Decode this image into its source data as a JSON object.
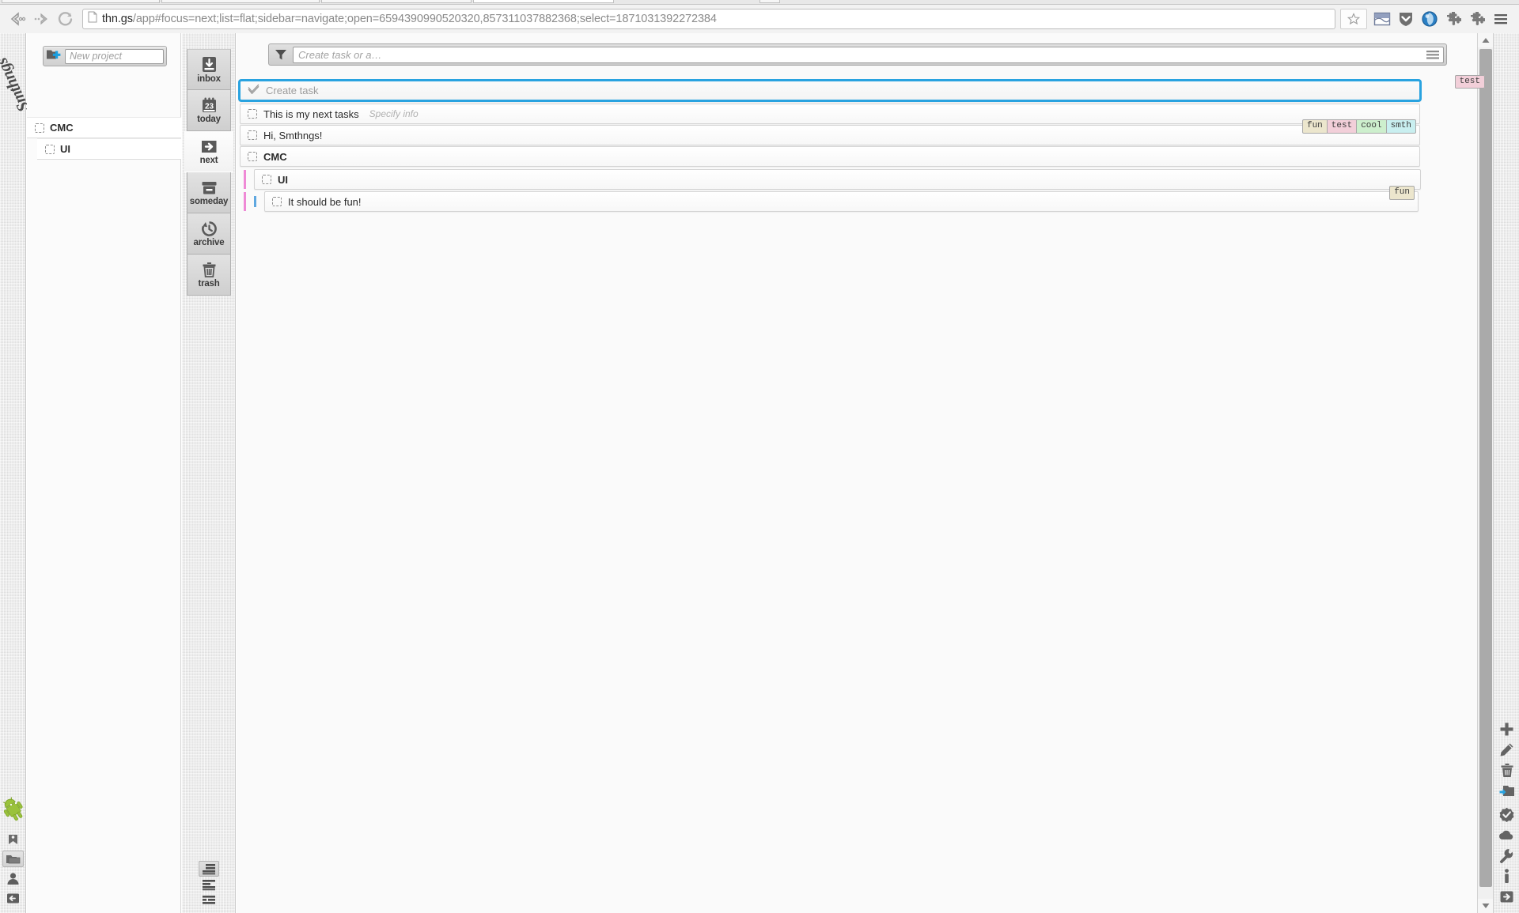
{
  "browser": {
    "url_host": "thn.gs",
    "url_path": "/app#focus=next;list=flat;sidebar=navigate;open=6594390990520320,857311037882368;select=1871031392272384",
    "back_icon": "back-arrow-icon",
    "forward_icon": "forward-arrow-icon",
    "reload_icon": "reload-icon",
    "page_icon": "page-document-icon",
    "star_icon": "bookmark-star-icon",
    "toolbar_icons": [
      "panel-split-icon",
      "shield-chevron-down-icon",
      "globe-blue-icon",
      "puzzle-piece-icon",
      "puzzle-piece-icon",
      "hamburger-menu-icon"
    ]
  },
  "brand": {
    "name": "Smthngs",
    "rail_icons": [
      "android-robot-icon",
      "tag-lock-icon",
      "folder-icon",
      "person-icon",
      "login-arrow-icon"
    ],
    "rail_selected_index": 2
  },
  "sidebar": {
    "new_project_placeholder": "New project",
    "new_project_icon": "new-folder-plus-icon",
    "projects": [
      {
        "label": "CMC",
        "level": 0,
        "icon": "dashed-checkbox-icon"
      },
      {
        "label": "UI",
        "level": 1,
        "icon": "dashed-checkbox-icon"
      }
    ]
  },
  "focus_nav": {
    "items": [
      {
        "label": "inbox",
        "icon": "inbox-download-icon",
        "active": false
      },
      {
        "label": "today",
        "icon": "calendar-23-icon",
        "active": false,
        "day": "23"
      },
      {
        "label": "next",
        "icon": "next-arrow-icon",
        "active": true
      },
      {
        "label": "someday",
        "icon": "archive-box-icon",
        "active": false
      },
      {
        "label": "archive",
        "icon": "clock-back-icon",
        "active": false
      },
      {
        "label": "trash",
        "icon": "trash-can-icon",
        "active": false
      }
    ],
    "view_toggles": [
      {
        "icon": "list-view-indented-icon",
        "selected": true
      },
      {
        "icon": "list-view-flat-icon",
        "selected": false
      },
      {
        "icon": "list-view-compact-icon",
        "selected": false
      }
    ]
  },
  "main": {
    "filter": {
      "icon": "filter-funnel-icon",
      "placeholder": "Create task or a…",
      "menu_icon": "hamburger-menu-icon"
    },
    "floating_tag": {
      "label": "test",
      "color": "#f2cfd9"
    },
    "tasks": [
      {
        "label": "Create task",
        "icon": "checkmark-outline-icon",
        "state": "create",
        "bold": false,
        "hint": "",
        "indent": 0,
        "tags": []
      },
      {
        "label": "This is my next tasks",
        "icon": "dashed-checkbox-icon",
        "state": "normal",
        "bold": false,
        "hint": "Specify info",
        "indent": 0,
        "tags": []
      },
      {
        "label": "Hi, Smthngs!",
        "icon": "dashed-checkbox-icon",
        "state": "normal",
        "bold": false,
        "hint": "",
        "indent": 0,
        "tags": [
          {
            "label": "fun",
            "color": "#ece6cd"
          },
          {
            "label": "test",
            "color": "#f2cfd9"
          },
          {
            "label": "cool",
            "color": "#cdefcd"
          },
          {
            "label": "smth",
            "color": "#c9eff0"
          }
        ]
      },
      {
        "label": "CMC",
        "icon": "dashed-checkbox-icon",
        "state": "normal",
        "bold": true,
        "hint": "",
        "indent": 0,
        "tags": []
      },
      {
        "label": "UI",
        "icon": "dashed-checkbox-icon",
        "state": "normal",
        "bold": true,
        "hint": "",
        "indent": 1,
        "bars": [
          "#ef8ad6"
        ],
        "tags": []
      },
      {
        "label": "It should be fun!",
        "icon": "dashed-checkbox-icon",
        "state": "normal",
        "bold": false,
        "hint": "",
        "indent": 2,
        "bars": [
          "#ef8ad6",
          "#5fa8e0"
        ],
        "tags": [
          {
            "label": "fun",
            "color": "#ece6cd"
          }
        ]
      }
    ]
  },
  "right_toolbar": {
    "items": [
      {
        "icon": "plus-add-icon"
      },
      {
        "icon": "pencil-edit-icon"
      },
      {
        "icon": "trash-delete-icon"
      },
      {
        "icon": "folder-move-icon"
      },
      {
        "icon": "check-badge-icon"
      },
      {
        "icon": "cloud-sync-icon"
      },
      {
        "icon": "wrench-settings-icon"
      },
      {
        "icon": "info-icon"
      },
      {
        "icon": "logout-arrow-icon"
      }
    ]
  },
  "scrollbar": {
    "up_icon": "scroll-up-arrow-icon",
    "down_icon": "scroll-down-arrow-icon"
  },
  "colors": {
    "accent_blue": "#29a3e0",
    "indent_pink": "#ef8ad6",
    "indent_blue": "#5fa8e0"
  }
}
